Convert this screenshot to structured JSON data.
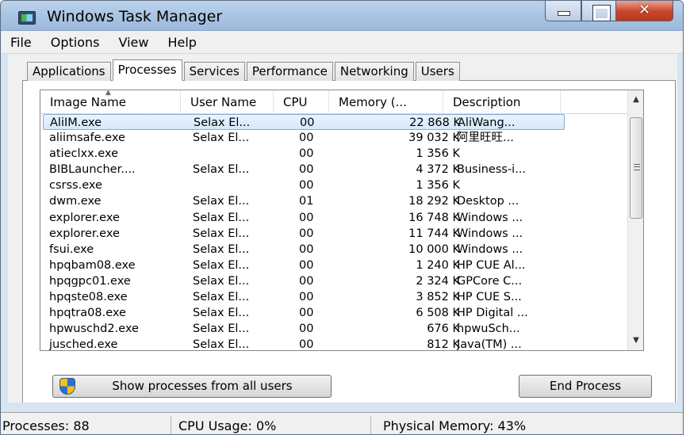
{
  "window": {
    "title": "Windows Task Manager"
  },
  "menu": [
    "File",
    "Options",
    "View",
    "Help"
  ],
  "tabs": [
    "Applications",
    "Processes",
    "Services",
    "Performance",
    "Networking",
    "Users"
  ],
  "active_tab": "Processes",
  "columns": [
    "Image Name",
    "User Name",
    "CPU",
    "Memory (...",
    "Description"
  ],
  "processes": [
    {
      "name": "AliIM.exe",
      "user": "Selax El...",
      "cpu": "00",
      "mem": "22 868 K",
      "desc": "AliWang..."
    },
    {
      "name": "aliimsafe.exe",
      "user": "Selax El...",
      "cpu": "00",
      "mem": "39 032 K",
      "desc": "阿里旺旺..."
    },
    {
      "name": "atieclxx.exe",
      "user": "",
      "cpu": "00",
      "mem": "1 356 K",
      "desc": ""
    },
    {
      "name": "BIBLauncher....",
      "user": "Selax El...",
      "cpu": "00",
      "mem": "4 372 K",
      "desc": "Business-i..."
    },
    {
      "name": "csrss.exe",
      "user": "",
      "cpu": "00",
      "mem": "1 356 K",
      "desc": ""
    },
    {
      "name": "dwm.exe",
      "user": "Selax El...",
      "cpu": "01",
      "mem": "18 292 K",
      "desc": "Desktop ..."
    },
    {
      "name": "explorer.exe",
      "user": "Selax El...",
      "cpu": "00",
      "mem": "16 748 K",
      "desc": "Windows ..."
    },
    {
      "name": "explorer.exe",
      "user": "Selax El...",
      "cpu": "00",
      "mem": "11 744 K",
      "desc": "Windows ..."
    },
    {
      "name": "fsui.exe",
      "user": "Selax El...",
      "cpu": "00",
      "mem": "10 000 K",
      "desc": "Windows ..."
    },
    {
      "name": "hpqbam08.exe",
      "user": "Selax El...",
      "cpu": "00",
      "mem": "1 240 K",
      "desc": "HP CUE Al..."
    },
    {
      "name": "hpqgpc01.exe",
      "user": "Selax El...",
      "cpu": "00",
      "mem": "2 324 K",
      "desc": "GPCore C..."
    },
    {
      "name": "hpqste08.exe",
      "user": "Selax El...",
      "cpu": "00",
      "mem": "3 852 K",
      "desc": "HP CUE S..."
    },
    {
      "name": "hpqtra08.exe",
      "user": "Selax El...",
      "cpu": "00",
      "mem": "6 508 K",
      "desc": "HP Digital ..."
    },
    {
      "name": "hpwuschd2.exe",
      "user": "Selax El...",
      "cpu": "00",
      "mem": "676 K",
      "desc": "hpwuSch..."
    },
    {
      "name": "jusched.exe",
      "user": "Selax El...",
      "cpu": "00",
      "mem": "812 K",
      "desc": "Java(TM) ..."
    }
  ],
  "buttons": {
    "show_all": "Show processes from all users",
    "end_process": "End Process"
  },
  "status": {
    "processes": "Processes: 88",
    "cpu": "CPU Usage: 0%",
    "memory": "Physical Memory: 43%"
  },
  "colors": {
    "selection": "#d5e8fb",
    "title_bar": "#a8c3e2",
    "close_button": "#c7442a"
  }
}
